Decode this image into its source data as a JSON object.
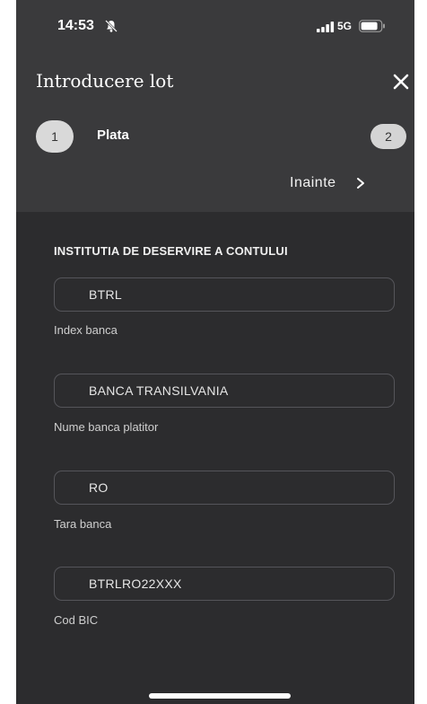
{
  "status_bar": {
    "time": "14:53",
    "network": "5G"
  },
  "header": {
    "title": "Introducere lot",
    "steps": [
      {
        "number": "1",
        "label": "Plata"
      },
      {
        "number": "2"
      }
    ],
    "next_label": "Inainte"
  },
  "form": {
    "section_title": "INSTITUTIA DE DESERVIRE A CONTULUI",
    "fields": [
      {
        "value": "BTRL",
        "label": "Index banca"
      },
      {
        "value": "BANCA TRANSILVANIA",
        "label": "Nume banca platitor"
      },
      {
        "value": "RO",
        "label": "Tara banca"
      },
      {
        "value": "BTRLRO22XXX",
        "label": "Cod BIC"
      }
    ]
  },
  "icons": {
    "bell": "bell-slash-icon",
    "signal": "signal-bars-icon",
    "battery": "battery-icon",
    "close": "close-icon",
    "next": "chevron-right-icon"
  }
}
